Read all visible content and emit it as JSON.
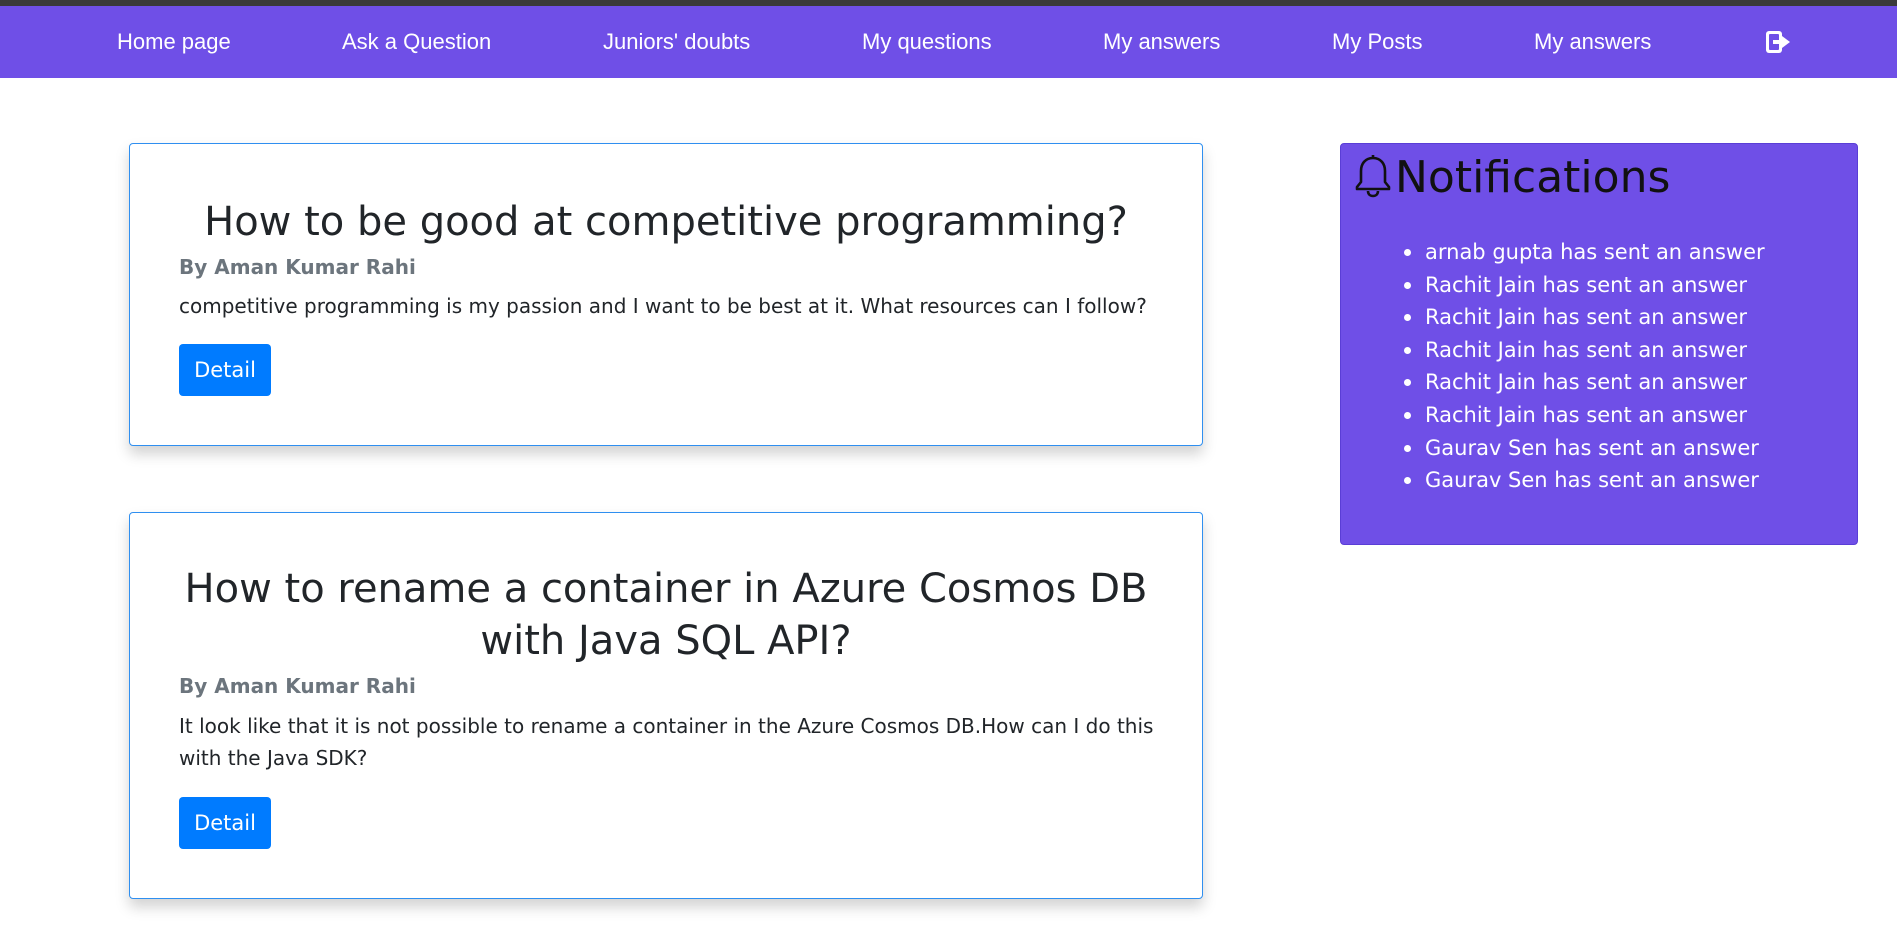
{
  "nav": {
    "items": [
      {
        "label": "Home page"
      },
      {
        "label": "Ask a Question"
      },
      {
        "label": "Juniors' doubts"
      },
      {
        "label": "My questions"
      },
      {
        "label": "My answers"
      },
      {
        "label": "My Posts"
      },
      {
        "label": "My answers"
      }
    ],
    "logout_icon": "logout-icon"
  },
  "posts": [
    {
      "title": "How to be good at competitive programming?",
      "author": "By Aman Kumar Rahi",
      "body": "competitive programming is my passion and I want to be best at it. What resources can I follow?",
      "button": "Detail"
    },
    {
      "title": "How to rename a container in Azure Cosmos DB with Java SQL API?",
      "author": "By Aman Kumar Rahi",
      "body": "It look like that it is not possible to rename a container in the Azure Cosmos DB.How can I do this with the Java SDK?",
      "button": "Detail"
    }
  ],
  "notifications": {
    "title": "Notifications",
    "icon": "bell-icon",
    "items": [
      "arnab gupta has sent an answer",
      "Rachit Jain has sent an answer",
      "Rachit Jain has sent an answer",
      "Rachit Jain has sent an answer",
      "Rachit Jain has sent an answer",
      "Rachit Jain has sent an answer",
      "Gaurav Sen has sent an answer",
      "Gaurav Sen has sent an answer"
    ]
  },
  "colors": {
    "nav_bg": "#6f4fe7",
    "accent_button": "#007bff",
    "card_border": "#2f8ff0"
  }
}
